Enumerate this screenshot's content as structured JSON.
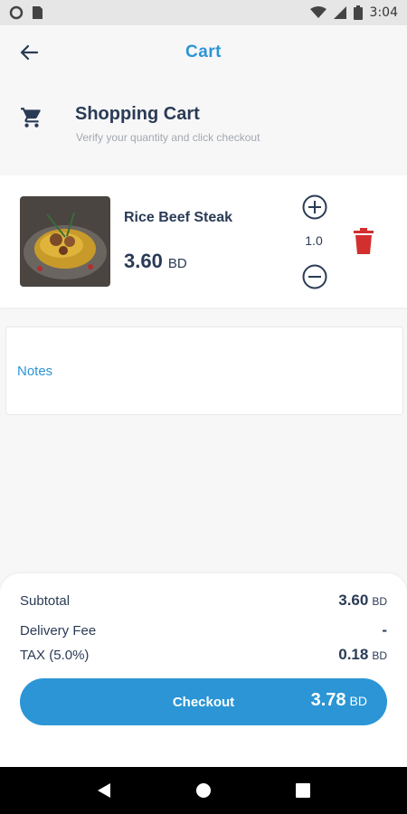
{
  "status_bar": {
    "time": "3:04"
  },
  "header": {
    "title": "Cart"
  },
  "cart_heading": {
    "title": "Shopping Cart",
    "subtitle": "Verify your quantity and click checkout"
  },
  "items": [
    {
      "name": "Rice Beef Steak",
      "price": "3.60",
      "currency": "BD",
      "quantity": "1.0"
    }
  ],
  "notes": {
    "label": "Notes"
  },
  "summary": {
    "subtotal_label": "Subtotal",
    "subtotal_value": "3.60",
    "subtotal_currency": "BD",
    "delivery_label": "Delivery Fee",
    "delivery_value": "-",
    "tax_label": "TAX (5.0%)",
    "tax_value": "0.18",
    "tax_currency": "BD"
  },
  "checkout": {
    "label": "Checkout",
    "total": "3.78",
    "currency": "BD"
  },
  "colors": {
    "accent": "#2b95d6",
    "danger": "#d32f2f",
    "text": "#2a3b55"
  }
}
